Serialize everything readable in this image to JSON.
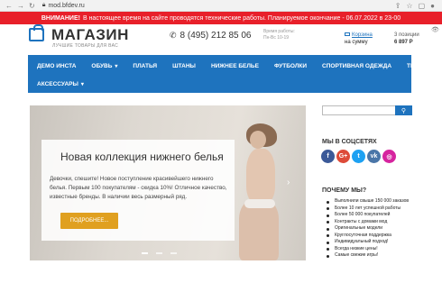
{
  "browser": {
    "url": "mod.bfdev.ru"
  },
  "alert": {
    "label": "ВНИМАНИЕ!",
    "text": "В настоящее время на сайте проводятся технические работы. Планируемое окончание - 06.07.2022 в 23-00"
  },
  "header": {
    "logo_title": "МАГАЗИН",
    "logo_subtitle": "ЛУЧШИЕ ТОВАРЫ ДЛЯ ВАС",
    "phone": "8 (495) 212 85 06",
    "hours_label": "Время работы:",
    "hours_value": "Пн-Вс 10-19",
    "cart_link": "Корзина",
    "cart_summary_prefix": "на сумму",
    "cart_items": "3 позиции",
    "cart_total": "6 897 Р"
  },
  "menu": {
    "row1": [
      {
        "label": "ДЕМО ИНСТА",
        "caret": false
      },
      {
        "label": "ОБУВЬ",
        "caret": true
      },
      {
        "label": "ПЛАТЬЯ",
        "caret": false
      },
      {
        "label": "ШТАНЫ",
        "caret": false
      },
      {
        "label": "НИЖНЕЕ БЕЛЬЕ",
        "caret": false
      },
      {
        "label": "ФУТБОЛКИ",
        "caret": false
      },
      {
        "label": "СПОРТИВНАЯ ОДЕЖДА",
        "caret": false
      },
      {
        "label": "ТЕСТОВЫЙ",
        "caret": false
      }
    ],
    "row2": [
      {
        "label": "АКСЕССУАРЫ",
        "caret": true
      }
    ]
  },
  "slide": {
    "title": "Новая коллекция нижнего белья",
    "text": "Девочки, спешите! Новое поступление красивейшего нижнего белья. Первым 100 покупателям - скидка 10%! Отличное качество, известные бренды. В наличии весь размерный ряд.",
    "button": "ПОДРОБНЕЕ..."
  },
  "sidebar": {
    "social_title": "МЫ В СОЦСЕТЯХ",
    "social": [
      {
        "name": "facebook",
        "glyph": "f",
        "color": "#3b5998"
      },
      {
        "name": "google-plus",
        "glyph": "G+",
        "color": "#dd4b39"
      },
      {
        "name": "twitter",
        "glyph": "t",
        "color": "#1da1f2"
      },
      {
        "name": "vkontakte",
        "glyph": "vk",
        "color": "#4a76a8"
      },
      {
        "name": "instagram",
        "glyph": "◎",
        "color": "#d6249f"
      }
    ],
    "why_title": "ПОЧЕМУ МЫ?",
    "why_items": [
      "Выполнили свыше 150 000 заказов",
      "Более 10 лет успешной работы",
      "Более 50 000 покупателей",
      "Контракты с домами мод",
      "Оригинальные модели",
      "Круглосуточная поддержка",
      "Индивидуальный подход!",
      "Всегда низкие цены!",
      "Самые свежие игры!"
    ]
  }
}
